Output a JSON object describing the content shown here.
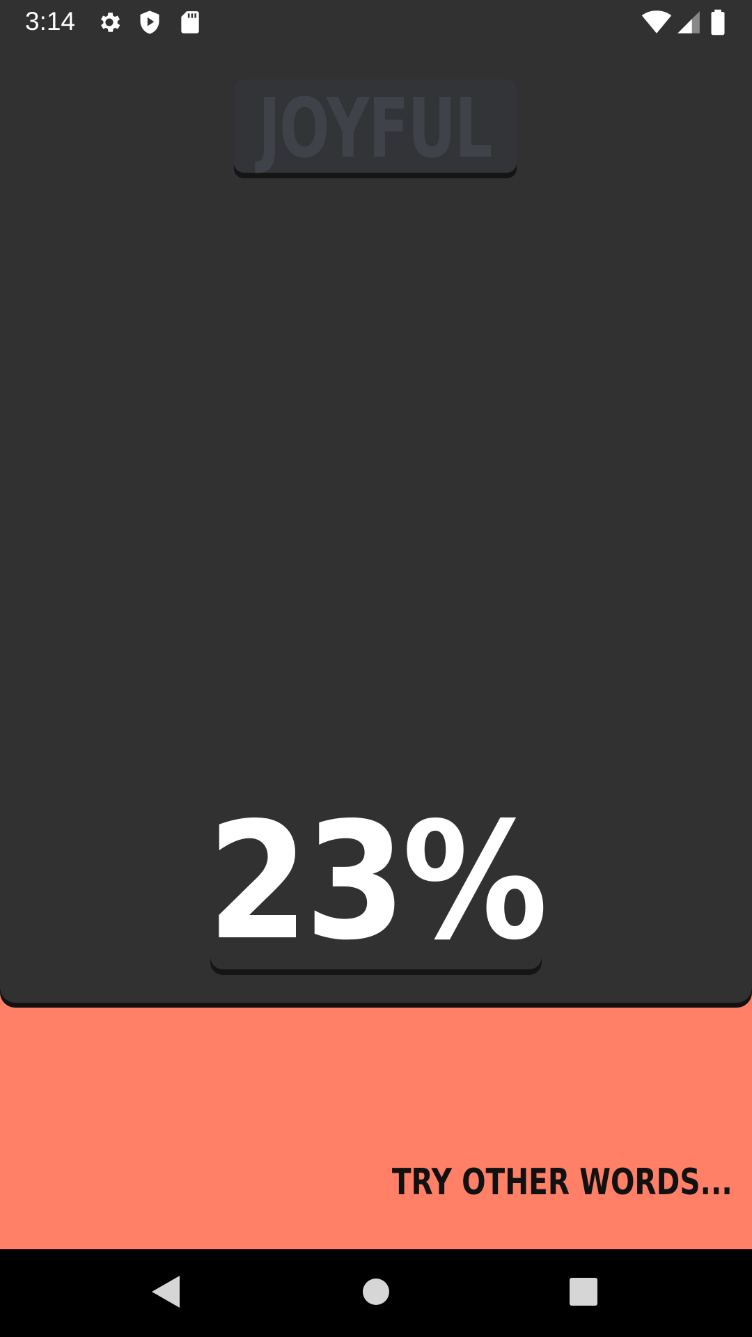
{
  "status_bar": {
    "time": "3:14",
    "icons_left": [
      "gear-icon",
      "shield-play-icon",
      "sd-card-icon"
    ],
    "icons_right": [
      "wifi-icon",
      "signal-icon",
      "battery-icon"
    ]
  },
  "word_card": {
    "word": "JOYFUL"
  },
  "result": {
    "percent_text": "23%",
    "percent_value": 23
  },
  "footer": {
    "try_other_label": "TRY OTHER WORDS..."
  },
  "nav_bar": {
    "buttons": [
      "back",
      "home",
      "recents"
    ]
  },
  "colors": {
    "panel": "#313131",
    "accent": "#FF8066",
    "word_text": "#3F4249",
    "percent_text": "#FFFFFF",
    "nav_bar": "#000000"
  }
}
